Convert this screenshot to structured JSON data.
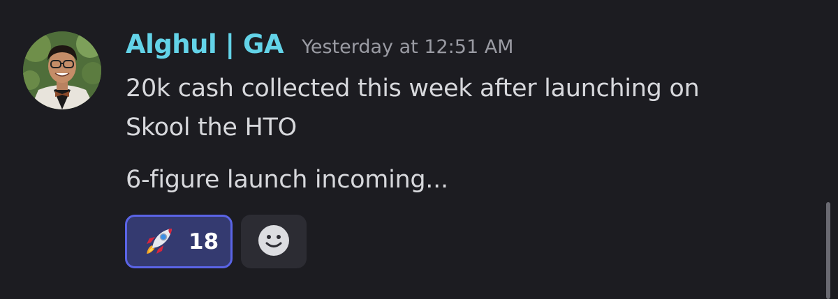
{
  "message": {
    "username": "Alghul | GA",
    "timestamp": "Yesterday at 12:51 AM",
    "lines": [
      "20k cash collected this week after launching on",
      "Skool the HTO",
      "6-figure launch incoming..."
    ]
  },
  "reactions": [
    {
      "icon": "rocket-icon",
      "count": "18",
      "selected": true
    }
  ],
  "add_reaction": {
    "icon": "smiley-face-icon"
  },
  "colors": {
    "background": "#1c1c21",
    "username": "#63d3e8",
    "timestamp": "#9a9ba3",
    "text": "#d7d8dc",
    "reaction_border": "#5a64e6",
    "reaction_bg": "#343a70"
  }
}
